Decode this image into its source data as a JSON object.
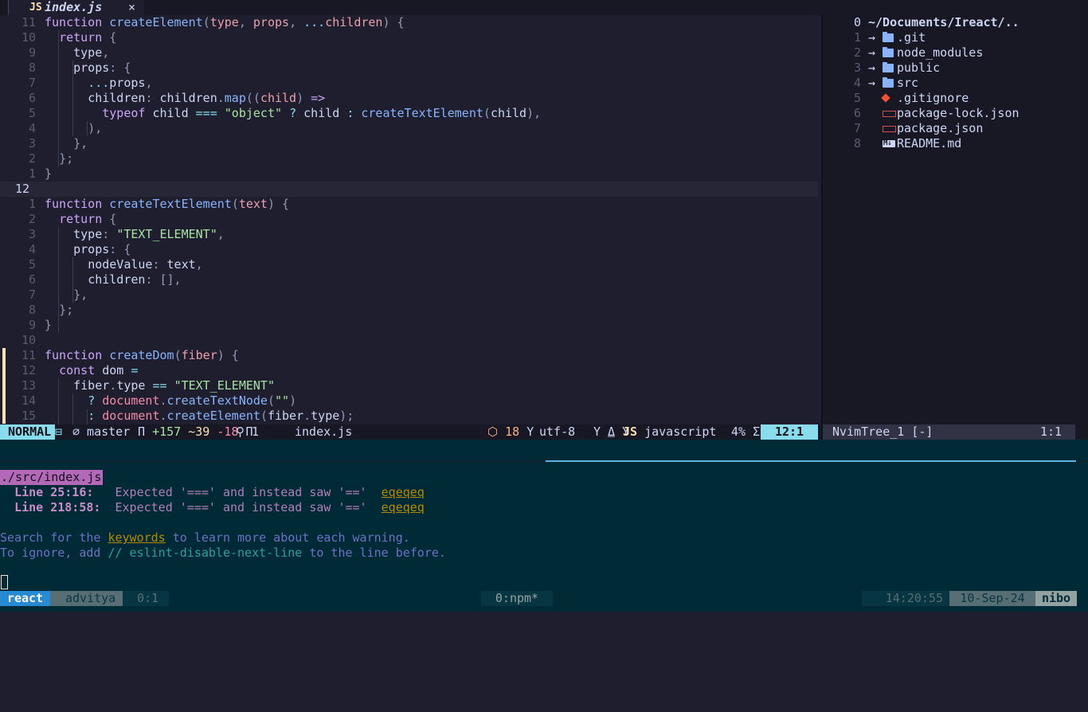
{
  "colors": {
    "mode_bg": "#89dceb",
    "accent_blue": "#268bd2",
    "terminal_bg": "#002b36",
    "editor_bg": "#1e1e2e"
  },
  "tab": {
    "icon": "JS",
    "filename": "index.js",
    "close": "×"
  },
  "editor": {
    "lines": [
      {
        "n": "11",
        "html": "<span class='kw'>function</span> <span class='fn'>createElement</span><span class='pu'>(</span><span class='pa'>type</span><span class='pu'>, </span><span class='pa'>props</span><span class='pu'>, </span><span class='op'>...</span><span class='pa'>children</span><span class='pu'>) {</span>"
      },
      {
        "n": "10",
        "html": "  <span class='kw'>return</span> <span class='pu'>{</span>"
      },
      {
        "n": "9",
        "html": "    <span class='pr'>type</span><span class='pu'>,</span>"
      },
      {
        "n": "8",
        "html": "    <span class='pr'>props</span><span class='pu'>: {</span>"
      },
      {
        "n": "7",
        "html": "      <span class='op'>...</span><span class='tx'>props</span><span class='pu'>,</span>"
      },
      {
        "n": "6",
        "html": "      <span class='pr'>children</span><span class='pu'>: </span><span class='tx'>children</span><span class='pu'>.</span><span class='fn'>map</span><span class='pu'>((</span><span class='pa'>child</span><span class='pu'>) </span><span class='kw'>=&gt;</span>"
      },
      {
        "n": "5",
        "html": "        <span class='kw'>typeof</span> <span class='tx'>child</span> <span class='op'>===</span> <span class='st'>\"object\"</span> <span class='op'>?</span> <span class='tx'>child</span> <span class='op'>:</span> <span class='fn'>createTextElement</span><span class='pu'>(</span><span class='tx'>child</span><span class='pu'>),</span>"
      },
      {
        "n": "4",
        "html": "      <span class='pu'>),</span>"
      },
      {
        "n": "3",
        "html": "    <span class='pu'>},</span>"
      },
      {
        "n": "2",
        "html": "  <span class='pu'>};</span>"
      },
      {
        "n": "1",
        "html": "<span class='pu'>}</span>"
      },
      {
        "n": "12",
        "html": "",
        "current": true
      },
      {
        "n": "1",
        "html": "<span class='kw'>function</span> <span class='fn'>createTextElement</span><span class='pu'>(</span><span class='pa'>text</span><span class='pu'>) {</span>"
      },
      {
        "n": "2",
        "html": "  <span class='kw'>return</span> <span class='pu'>{</span>"
      },
      {
        "n": "3",
        "html": "    <span class='pr'>type</span><span class='pu'>: </span><span class='st'>\"TEXT_ELEMENT\"</span><span class='pu'>,</span>"
      },
      {
        "n": "4",
        "html": "    <span class='pr'>props</span><span class='pu'>: {</span>"
      },
      {
        "n": "5",
        "html": "      <span class='pr'>nodeValue</span><span class='pu'>: </span><span class='tx'>text</span><span class='pu'>,</span>"
      },
      {
        "n": "6",
        "html": "      <span class='pr'>children</span><span class='pu'>: [],</span>"
      },
      {
        "n": "7",
        "html": "    <span class='pu'>},</span>"
      },
      {
        "n": "8",
        "html": "  <span class='pu'>};</span>"
      },
      {
        "n": "9",
        "html": "<span class='pu'>}</span>"
      },
      {
        "n": "10",
        "html": ""
      },
      {
        "n": "11",
        "html": "<span class='kw'>function</span> <span class='fn'>createDom</span><span class='pu'>(</span><span class='pa'>fiber</span><span class='pu'>) {</span>",
        "git": true
      },
      {
        "n": "12",
        "html": "  <span class='kw'>const</span> <span class='tx'>dom</span> <span class='op'>=</span>",
        "git": true
      },
      {
        "n": "13",
        "html": "    <span class='tx'>fiber</span><span class='pu'>.</span><span class='pr'>type</span> <span class='op'>==</span> <span class='st'>\"TEXT_ELEMENT\"</span>",
        "git": true
      },
      {
        "n": "14",
        "html": "      <span class='op'>?</span> <span class='bi'>document</span><span class='pu'>.</span><span class='fn'>createTextNode</span><span class='pu'>(</span><span class='st'>\"\"</span><span class='pu'>)</span>",
        "git": true
      },
      {
        "n": "15",
        "html": "      <span class='op'>:</span> <span class='bi'>document</span><span class='pu'>.</span><span class='fn'>createElement</span><span class='pu'>(</span><span class='tx'>fiber</span><span class='pu'>.</span><span class='pr'>type</span><span class='pu'>);</span>",
        "git": true
      }
    ]
  },
  "tree": {
    "root": {
      "idx": "0",
      "label": "~/Documents/Ireact/.."
    },
    "items": [
      {
        "idx": "1",
        "label": ".git",
        "icon": "folder",
        "arrow": "→"
      },
      {
        "idx": "2",
        "label": "node_modules",
        "icon": "folder",
        "arrow": "→"
      },
      {
        "idx": "3",
        "label": "public",
        "icon": "folder",
        "arrow": "→"
      },
      {
        "idx": "4",
        "label": "src",
        "icon": "folder",
        "arrow": "→"
      },
      {
        "idx": "5",
        "label": ".gitignore",
        "icon": "git"
      },
      {
        "idx": "6",
        "label": "package-lock.json",
        "icon": "json"
      },
      {
        "idx": "7",
        "label": "package.json",
        "icon": "json"
      },
      {
        "idx": "8",
        "label": "README.md",
        "icon": "markdown"
      }
    ]
  },
  "status": {
    "mode": "NORMAL",
    "branch": "⌀ master",
    "diff_added": "+157",
    "diff_changed": "~39",
    "diff_removed": "-18",
    "diagnostics": "⚲ 1",
    "file": "index.js",
    "problems": "18",
    "encoding": "utf-8",
    "filetype_icon": "JS",
    "filetype": "javascript",
    "percent": "4%",
    "position": "12:1",
    "tree_name": "NvimTree_1 [-]",
    "tree_pos": "1:1"
  },
  "terminal": {
    "file_tag": "./src/index.js",
    "warnings": [
      {
        "loc": "Line 25:16:",
        "msg": "Expected '===' and instead saw '=='",
        "rule": "eqeqeq"
      },
      {
        "loc": "Line 218:58:",
        "msg": "Expected '===' and instead saw '=='",
        "rule": "eqeqeq"
      }
    ],
    "hint1_pre": "Search for the ",
    "hint1_link": "keywords",
    "hint1_post": " to learn more about each warning.",
    "hint2_pre": "To ignore, add ",
    "hint2_code": "// eslint-disable-next-line",
    "hint2_post": " to the line before."
  },
  "tmux": {
    "session": "react",
    "user": "advitya",
    "pane": "0:1",
    "window": "0:npm*",
    "time": "14:20:55",
    "date": "10-Sep-24",
    "host": "nibo"
  }
}
